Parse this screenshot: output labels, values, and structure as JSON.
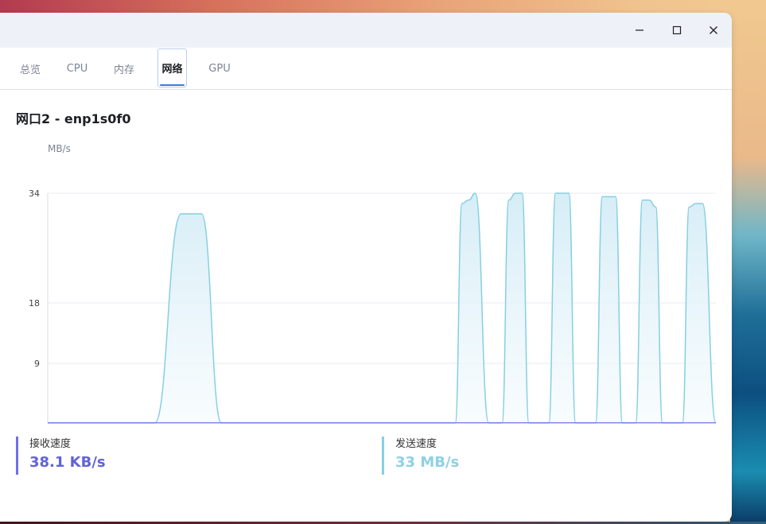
{
  "window": {
    "controls": {
      "minimize_icon": "minimize-icon",
      "maximize_icon": "maximize-icon",
      "close_icon": "close-icon"
    }
  },
  "tabs": [
    {
      "label": "总览",
      "active": false
    },
    {
      "label": "CPU",
      "active": false
    },
    {
      "label": "内存",
      "active": false
    },
    {
      "label": "网络",
      "active": true
    },
    {
      "label": "GPU",
      "active": false
    }
  ],
  "section": {
    "title": "网口2 - enp1s0f0"
  },
  "chart": {
    "unit": "MB/s"
  },
  "chart_data": {
    "type": "area",
    "ylabel": "MB/s",
    "yticks": [
      9,
      18,
      34
    ],
    "ylim": [
      0,
      34
    ],
    "grid": true,
    "series": [
      {
        "color": "#86cfe3",
        "x": [
          0,
          16,
          20,
          23,
          26,
          30,
          60,
          61,
          62,
          63,
          64,
          66,
          67,
          68,
          69,
          70,
          71,
          72,
          74,
          75,
          76,
          77,
          78,
          79,
          80,
          82,
          83,
          84,
          85,
          86,
          88,
          89,
          90,
          91,
          92,
          94,
          95,
          96,
          97,
          98,
          100
        ],
        "values": [
          0,
          0,
          31,
          31,
          0,
          0,
          0,
          0,
          32.5,
          33,
          34,
          0,
          0,
          0,
          33,
          34,
          34,
          0,
          0,
          0,
          34,
          34,
          34,
          0,
          0,
          0,
          33.5,
          33.5,
          33.5,
          0,
          0,
          33,
          33,
          32,
          0,
          0,
          0,
          32,
          32.5,
          32.5,
          0
        ]
      },
      {
        "color": "#6f6fe6",
        "x": [
          0,
          100
        ],
        "values": [
          0.04,
          0.04
        ]
      }
    ]
  },
  "stats": {
    "rx": {
      "label": "接收速度",
      "value": "38.1 KB/s",
      "color": "#6262d8"
    },
    "tx": {
      "label": "发送速度",
      "value": "33 MB/s",
      "color": "#8fd0e4"
    }
  }
}
